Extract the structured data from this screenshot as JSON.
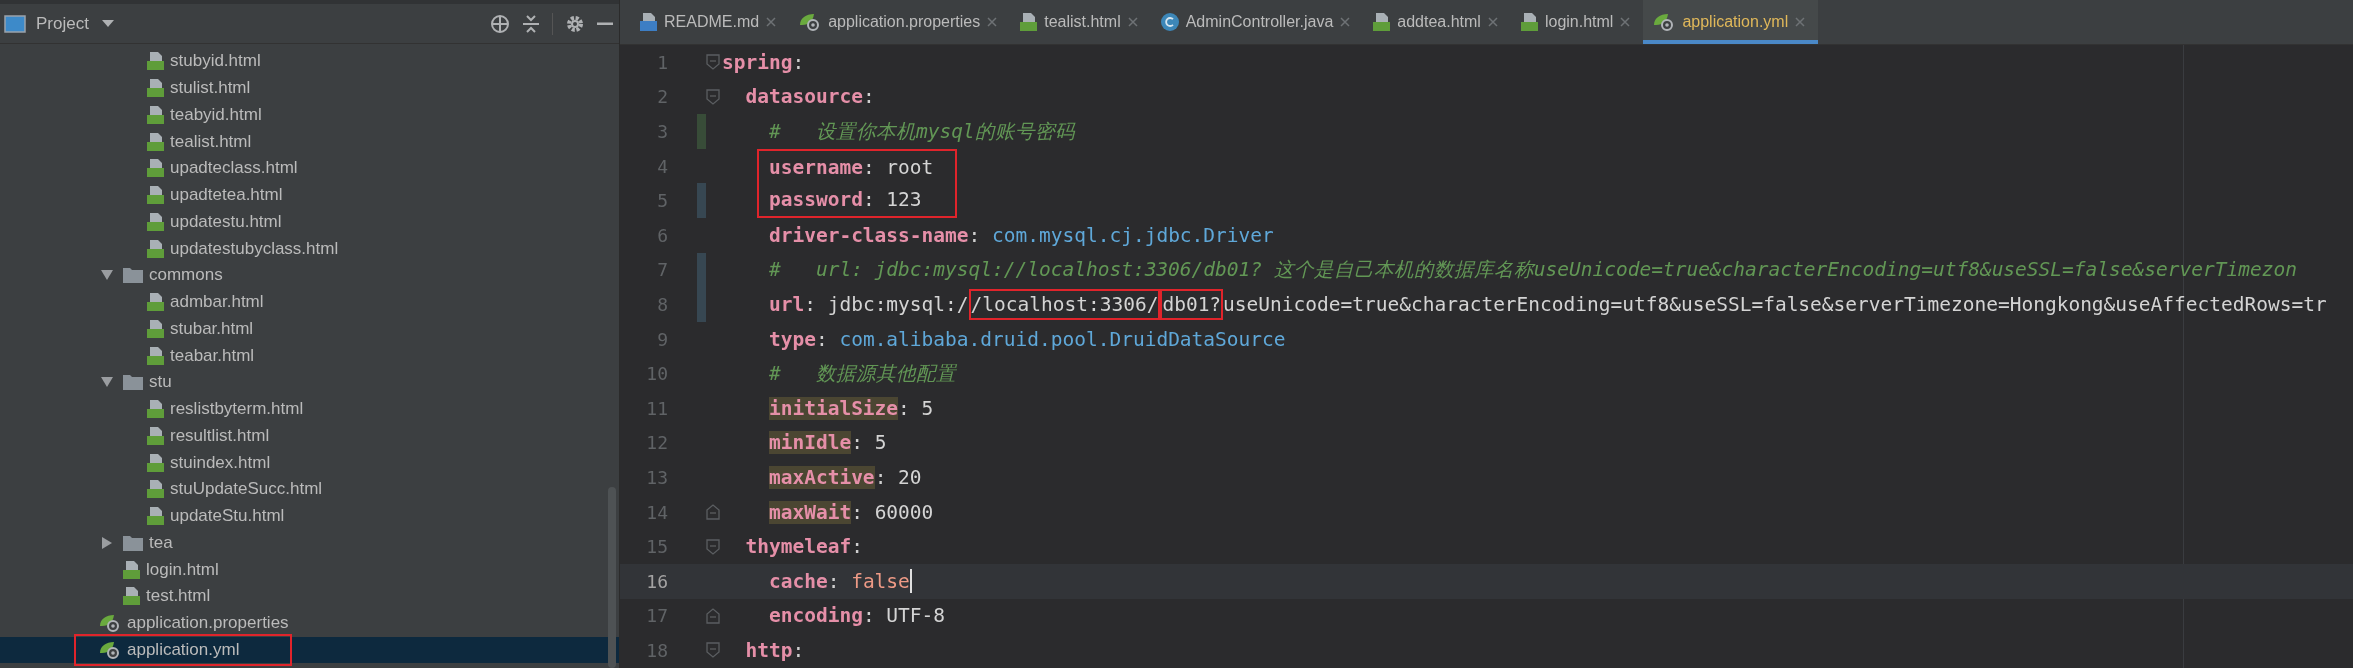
{
  "project_panel": {
    "title": "Project"
  },
  "tree": [
    {
      "children": [
        {
          "children": [
            {
              "label": "stubyid.html",
              "kind": "html",
              "selected": false
            },
            {
              "label": "stulist.html",
              "kind": "html",
              "selected": false
            },
            {
              "label": "teabyid.html",
              "kind": "html",
              "selected": false
            },
            {
              "label": "tealist.html",
              "kind": "html",
              "selected": false
            },
            {
              "label": "upadteclass.html",
              "kind": "html",
              "selected": false
            },
            {
              "label": "upadtetea.html",
              "kind": "html",
              "selected": false
            },
            {
              "label": "updatestu.html",
              "kind": "html",
              "selected": false
            },
            {
              "label": "updatestubyclass.html",
              "kind": "html",
              "selected": false
            }
          ]
        },
        {
          "label": "commons",
          "kind": "folder",
          "expanded": true,
          "selected": false,
          "children": [
            {
              "label": "admbar.html",
              "kind": "html",
              "selected": false
            },
            {
              "label": "stubar.html",
              "kind": "html",
              "selected": false
            },
            {
              "label": "teabar.html",
              "kind": "html",
              "selected": false
            }
          ]
        },
        {
          "label": "stu",
          "kind": "folder",
          "expanded": true,
          "selected": false,
          "children": [
            {
              "label": "reslistbyterm.html",
              "kind": "html",
              "selected": false
            },
            {
              "label": "resultlist.html",
              "kind": "html",
              "selected": false
            },
            {
              "label": "stuindex.html",
              "kind": "html",
              "selected": false
            },
            {
              "label": "stuUpdateSucc.html",
              "kind": "html",
              "selected": false
            },
            {
              "label": "updateStu.html",
              "kind": "html",
              "selected": false
            }
          ]
        },
        {
          "label": "tea",
          "kind": "folder",
          "expanded": false,
          "selected": false
        },
        {
          "label": "login.html",
          "kind": "html",
          "selected": false
        },
        {
          "label": "test.html",
          "kind": "html",
          "selected": false
        }
      ]
    },
    {
      "label": "application.properties",
      "kind": "spring",
      "selected": false
    },
    {
      "label": "application.yml",
      "kind": "spring",
      "selected": true,
      "boxed": true
    }
  ],
  "tabs": [
    {
      "label": "README.md",
      "kind": "md",
      "selected": false
    },
    {
      "label": "application.properties",
      "kind": "spring",
      "selected": false
    },
    {
      "label": "tealist.html",
      "kind": "html",
      "selected": false
    },
    {
      "label": "AdminController.java",
      "kind": "java",
      "selected": false
    },
    {
      "label": "addtea.html",
      "kind": "html",
      "selected": false
    },
    {
      "label": "login.html",
      "kind": "html",
      "selected": false
    },
    {
      "label": "application.yml",
      "kind": "spring",
      "selected": true
    }
  ],
  "code": [
    {
      "number": "1",
      "kind": "pair",
      "key": "spring",
      "separator": ":",
      "fold_start": true,
      "children": [
        {
          "number": "2",
          "kind": "pair",
          "key": "datasource",
          "separator": ":",
          "fold_start": true,
          "children": [
            {
              "number": "3",
              "kind": "comment",
              "text": "#   设置你本机mysql的账号密码",
              "added": true
            },
            {
              "number": "4",
              "kind": "pair",
              "key": "username",
              "separator": ":",
              "value": {
                "text": "root",
                "kind": "plain"
              },
              "boxed": true
            },
            {
              "number": "5",
              "kind": "pair",
              "key": "password",
              "separator": ":",
              "value": {
                "text": "123",
                "kind": "plain"
              },
              "boxed": true,
              "modified": true
            },
            {
              "number": "6",
              "kind": "pair",
              "key": "driver-class-name",
              "separator": ":",
              "value": {
                "text": "com.mysql.cj.jdbc.Driver",
                "kind": "class"
              }
            },
            {
              "number": "7",
              "kind": "comment",
              "text": "#   url: jdbc:mysql://localhost:3306/db01? 这个是自己本机的数据库名称useUnicode=true&characterEncoding=utf8&useSSL=false&serverTimezon",
              "modified": true
            },
            {
              "number": "8",
              "kind": "pair",
              "key": "url",
              "separator": ":",
              "value_parts": [
                {
                  "text": "jdbc:mysql:/",
                  "boxed": false
                },
                {
                  "text": "/localhost:3306/",
                  "boxed": true
                },
                {
                  "text": "db01?",
                  "boxed": true
                },
                {
                  "text": "useUnicode=true&characterEncoding=utf8&useSSL=false&serverTimezone=Hongkong&useAffectedRows=tr",
                  "boxed": false
                }
              ],
              "modified": true
            },
            {
              "number": "9",
              "kind": "pair",
              "key": "type",
              "separator": ":",
              "value": {
                "text": "com.alibaba.druid.pool.DruidDataSource",
                "kind": "class"
              }
            },
            {
              "number": "10",
              "kind": "comment",
              "text": "#   数据源其他配置"
            },
            {
              "number": "11",
              "kind": "pair",
              "key": "initialSize",
              "separator": ":",
              "value": {
                "text": "5",
                "kind": "plain"
              },
              "key_marked": true
            },
            {
              "number": "12",
              "kind": "pair",
              "key": "minIdle",
              "separator": ":",
              "value": {
                "text": "5",
                "kind": "plain"
              },
              "key_marked": true
            },
            {
              "number": "13",
              "kind": "pair",
              "key": "maxActive",
              "separator": ":",
              "value": {
                "text": "20",
                "kind": "plain"
              },
              "key_marked": true
            },
            {
              "number": "14",
              "kind": "pair",
              "key": "maxWait",
              "separator": ":",
              "value": {
                "text": "60000",
                "kind": "plain"
              },
              "key_marked": true,
              "fold_end": true
            }
          ]
        },
        {
          "number": "15",
          "kind": "pair",
          "key": "thymeleaf",
          "separator": ":",
          "fold_start": true,
          "children": [
            {
              "number": "16",
              "kind": "pair",
              "key": "cache",
              "separator": ":",
              "value": {
                "text": "false",
                "kind": "bool"
              },
              "current": true
            },
            {
              "number": "17",
              "kind": "pair",
              "key": "encoding",
              "separator": ":",
              "value": {
                "text": "UTF-8",
                "kind": "plain"
              },
              "fold_end": true
            }
          ]
        },
        {
          "number": "18",
          "kind": "pair",
          "key": "http",
          "separator": ":",
          "fold_start": true
        }
      ]
    }
  ]
}
